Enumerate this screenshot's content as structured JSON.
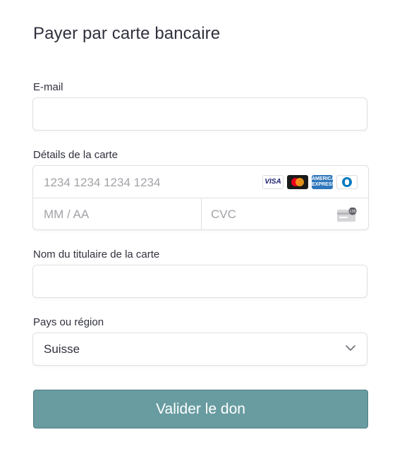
{
  "title": "Payer par carte bancaire",
  "email": {
    "label": "E-mail",
    "value": ""
  },
  "card": {
    "label": "Détails de la carte",
    "number_placeholder": "1234 1234 1234 1234",
    "expiry_placeholder": "MM / AA",
    "cvc_placeholder": "CVC",
    "cvc_icon_badge": "135",
    "brands": [
      {
        "name": "visa-logo",
        "text": "VISA"
      },
      {
        "name": "mastercard-logo"
      },
      {
        "name": "amex-logo",
        "text": "AMERICAN EXPRESS"
      },
      {
        "name": "diners-club-logo"
      }
    ]
  },
  "cardholder": {
    "label": "Nom du titulaire de la carte",
    "value": ""
  },
  "country": {
    "label": "Pays ou région",
    "selected": "Suisse"
  },
  "submit_label": "Valider le don",
  "colors": {
    "button_bg": "#689ca1",
    "text": "#30313d",
    "placeholder": "#a3a3a8"
  }
}
